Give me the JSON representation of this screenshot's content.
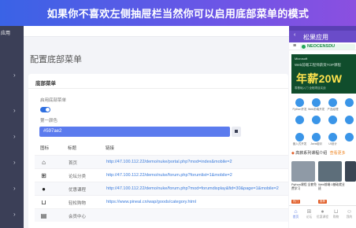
{
  "banner": {
    "text": "如果你不喜欢左侧抽屉栏当然你可以启用底部菜单的模式"
  },
  "sidebar": {
    "top_label": "应用"
  },
  "main": {
    "page_title": "配置底部菜单",
    "card_title": "底部菜单",
    "enable_label": "启用底部菜单",
    "enabled": true,
    "color_label": "第一颜色",
    "color_value": "#597ae2",
    "table": {
      "headers": {
        "icon": "图标",
        "title": "标题",
        "link": "链接"
      },
      "rows": [
        {
          "icon": "home-icon",
          "title": "首页",
          "link": "http://47.100.112.22/demo/nuke/portal.php?mod=index&mobile=2"
        },
        {
          "icon": "grid-icon",
          "title": "论坛分类",
          "link": "http://47.100.112.22/demo/nuke/forum.php?forumlist=1&mobile=2"
        },
        {
          "icon": "circle-arrow-icon",
          "title": "优惠课程",
          "link": "http://47.100.112.22/demo/nuke/forum.php?mod=forumdisplay&fid=30&page=1&mobile=2"
        },
        {
          "icon": "cart-icon",
          "title": "轻松购物",
          "link": "https://www.pineal.cn/wap/goods/category.html"
        },
        {
          "icon": "doc-icon",
          "title": "会员中心",
          "link": ""
        }
      ]
    }
  },
  "phone": {
    "app_title": "松果应用",
    "site_logo": "NEOCENSDU",
    "hero": {
      "tag": "Microsoft",
      "subtitle": "Web前端工程师薪资TOP课程",
      "big_text": "年薪20W",
      "footer": "零基础入门 全程项目实战"
    },
    "grid": [
      {
        "label": "Python开发"
      },
      {
        "label": "Web前端开发"
      },
      {
        "label": "产品经理"
      },
      {
        "label": ""
      },
      {
        "label": ""
      },
      {
        "label": ""
      },
      {
        "label": ""
      },
      {
        "label": ""
      },
      {
        "label": "嵌入式开发"
      },
      {
        "label": "Java培训"
      },
      {
        "label": "UI设计"
      },
      {
        "label": ""
      }
    ],
    "section": {
      "title": "高薪系列课程介绍",
      "more": "查看更多"
    },
    "thumbs": [
      {
        "caption": "Python课程 全套免费学习",
        "badge": "热门"
      },
      {
        "caption": "Web前端 0基础就业班",
        "badge": "推荐"
      },
      {
        "caption": "",
        "badge": ""
      }
    ],
    "nav": [
      {
        "icon": "home-icon",
        "label": "首页",
        "active": true
      },
      {
        "icon": "grid-icon",
        "label": "论坛",
        "active": false
      },
      {
        "icon": "circle-arrow-icon",
        "label": "优惠课程",
        "active": false
      },
      {
        "icon": "cart-icon",
        "label": "购物",
        "active": false
      },
      {
        "icon": "user-icon",
        "label": "我的",
        "active": false
      }
    ]
  },
  "colors": {
    "accent": "#597ae2",
    "phone_header": "#6a4cc9",
    "banner_start": "#3a63e6",
    "banner_end": "#8b4fe0",
    "sidebar": "#3b3f57"
  }
}
